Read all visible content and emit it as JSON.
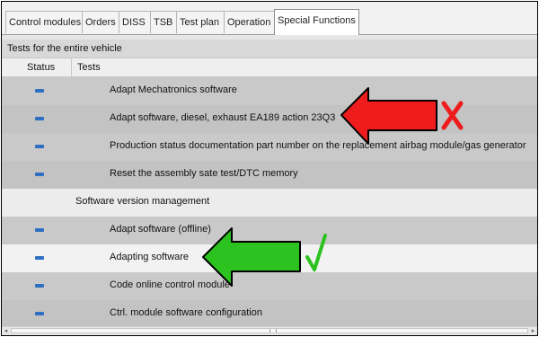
{
  "tabs": [
    {
      "label": "Control modules"
    },
    {
      "label": "Orders"
    },
    {
      "label": "DISS"
    },
    {
      "label": "TSB"
    },
    {
      "label": "Test plan"
    },
    {
      "label": "Operation"
    },
    {
      "label": "Special Functions",
      "active": true
    }
  ],
  "section": {
    "title": "Tests for the entire vehicle"
  },
  "columns": {
    "status": "Status",
    "tests": "Tests"
  },
  "rows": [
    {
      "label": "Adapt Mechatronics software",
      "status": "not-run"
    },
    {
      "label": "Adapt software, diesel, exhaust EA189 action 23Q3",
      "status": "not-run"
    },
    {
      "label": "Production status documentation part number on the replacement airbag module/gas generator",
      "status": "not-run"
    },
    {
      "label": "Reset the assembly sate test/DTC memory",
      "status": "not-run"
    },
    {
      "label": "Software version management",
      "group": true
    },
    {
      "label": "Adapt software (offline)",
      "status": "not-run"
    },
    {
      "label": "Adapting software",
      "status": "not-run",
      "selected": true
    },
    {
      "label": "Code online control module",
      "status": "not-run"
    },
    {
      "label": "Ctrl. module software configuration",
      "status": "not-run"
    }
  ],
  "annotations": {
    "wrong_arrow_color": "#ee1c1c",
    "wrong_mark": "x-mark-icon",
    "right_arrow_color": "#2cc21f",
    "right_mark": "check-mark-icon"
  }
}
